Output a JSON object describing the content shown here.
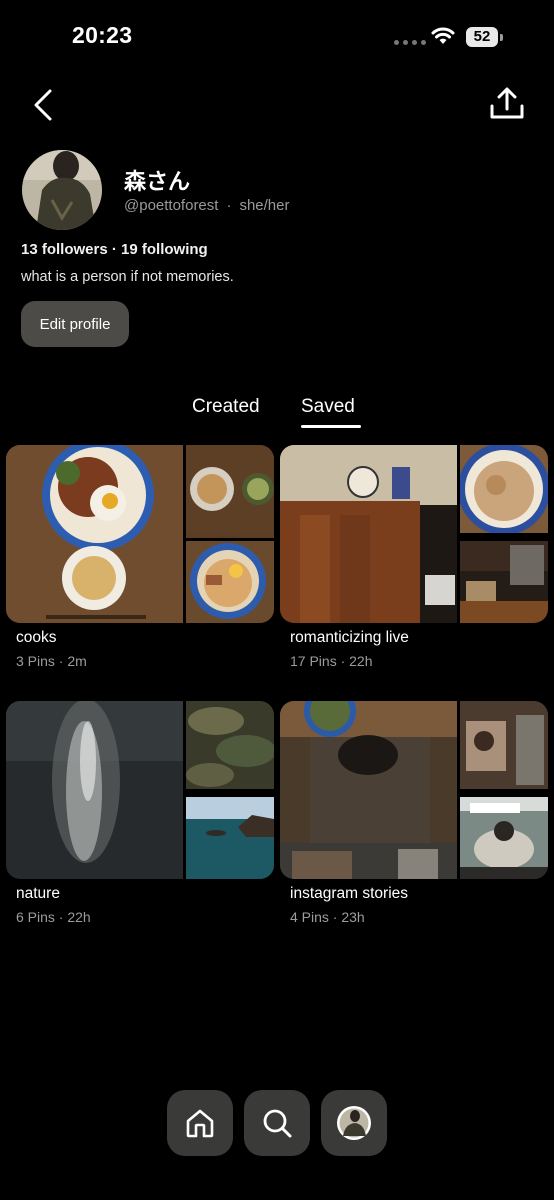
{
  "status_bar": {
    "time": "20:23",
    "battery": "52"
  },
  "profile": {
    "name": "森さん",
    "handle": "@poettoforest",
    "separator": "·",
    "pronouns": "she/her",
    "follow_stats": "13 followers · 19 following",
    "bio": "what is a person if not memories.",
    "edit_button": "Edit profile"
  },
  "tabs": [
    {
      "label": "Created",
      "active": false
    },
    {
      "label": "Saved",
      "active": true
    }
  ],
  "boards": [
    {
      "title": "cooks",
      "meta": "3 Pins · 2m"
    },
    {
      "title": "romanticizing live",
      "meta": "17 Pins · 22h"
    },
    {
      "title": "nature",
      "meta": "6 Pins · 22h"
    },
    {
      "title": "instagram stories",
      "meta": "4 Pins · 23h"
    }
  ],
  "bottom_nav": [
    "home-icon",
    "search-icon",
    "profile-avatar"
  ],
  "colors": {
    "background": "#000000",
    "button": "#4c4b47",
    "muted_text": "#9a9a9a"
  }
}
